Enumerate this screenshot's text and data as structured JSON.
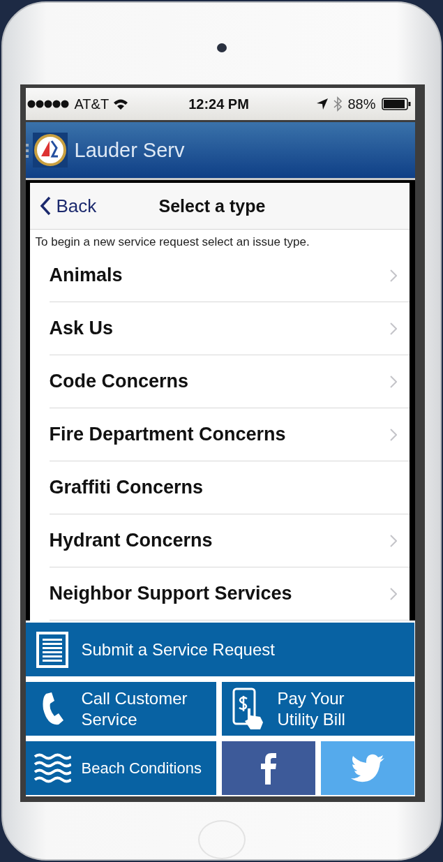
{
  "status_bar": {
    "carrier": "AT&T",
    "time": "12:24 PM",
    "battery": "88%"
  },
  "app_bar": {
    "title": "Lauder Serv"
  },
  "nav": {
    "back": "Back",
    "title": "Select a type"
  },
  "instruction": "To begin a new service request select an issue type.",
  "issue_types": [
    {
      "label": "Animals",
      "chevron": true
    },
    {
      "label": "Ask Us",
      "chevron": true
    },
    {
      "label": "Code Concerns",
      "chevron": true
    },
    {
      "label": "Fire Department Concerns",
      "chevron": true
    },
    {
      "label": "Graffiti Concerns",
      "chevron": false
    },
    {
      "label": "Hydrant Concerns",
      "chevron": true
    },
    {
      "label": "Neighbor Support Services",
      "chevron": true
    }
  ],
  "tiles": [
    {
      "kind": "document",
      "lines": [
        "Submit a Service Request"
      ]
    },
    {
      "kind": "phone",
      "lines": [
        "Call Customer",
        "Service"
      ]
    },
    {
      "kind": "pay",
      "lines": [
        "Pay Your",
        "Utility Bill"
      ]
    },
    {
      "kind": "waves",
      "lines": [
        "Beach Conditions"
      ]
    },
    {
      "kind": "facebook"
    },
    {
      "kind": "twitter"
    }
  ]
}
